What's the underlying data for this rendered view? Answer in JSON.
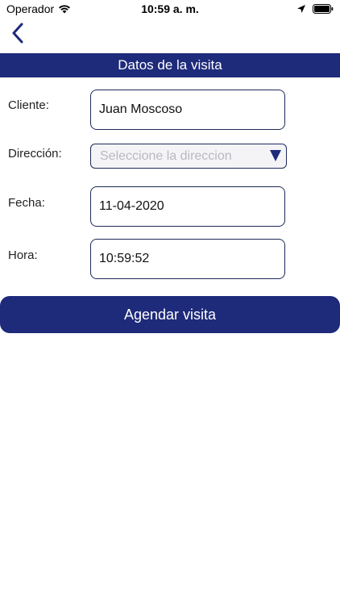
{
  "status_bar": {
    "carrier": "Operador",
    "time": "10:59 a. m."
  },
  "header": {
    "title": "Datos de la visita"
  },
  "form": {
    "cliente": {
      "label": "Cliente:",
      "value": "Juan Moscoso"
    },
    "direccion": {
      "label": "Dirección:",
      "placeholder": "Seleccione la direccion"
    },
    "fecha": {
      "label": "Fecha:",
      "value": "11-04-2020"
    },
    "hora": {
      "label": "Hora:",
      "value": "10:59:52"
    }
  },
  "actions": {
    "submit_label": "Agendar visita"
  },
  "colors": {
    "primary": "#1e2a7a",
    "placeholder": "#b9b9c0"
  },
  "icons": [
    "wifi-icon",
    "location-arrow-icon",
    "battery-icon",
    "back-chevron-icon",
    "dropdown-arrow-icon"
  ]
}
